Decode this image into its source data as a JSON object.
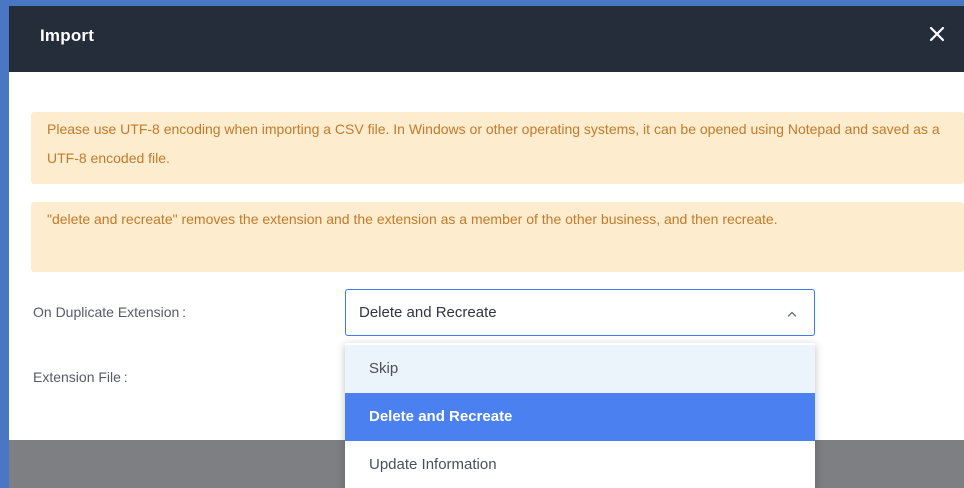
{
  "dialog": {
    "title": "Import",
    "close_icon": "close-icon"
  },
  "notices": [
    "Please use UTF-8 encoding when importing a CSV file. In Windows or other operating systems, it can be opened using Notepad and saved as a UTF-8 encoded file.",
    "\"delete and recreate\" removes the extension and the extension as a member of the other business, and then recreate."
  ],
  "form": {
    "duplicate_label": "On Duplicate Extension :",
    "file_label": "Extension File :",
    "duplicate_select": {
      "value": "Delete and Recreate",
      "chevron_icon": "chevron-up-icon",
      "options": [
        "Skip",
        "Delete and Recreate",
        "Update Information"
      ],
      "selected_index": 1
    }
  },
  "colors": {
    "header_bg": "#252d3a",
    "notice_bg": "#fdeccd",
    "notice_text": "#c27a2c",
    "accent": "#4a80f0",
    "hover_bg": "#ebf3fb"
  }
}
